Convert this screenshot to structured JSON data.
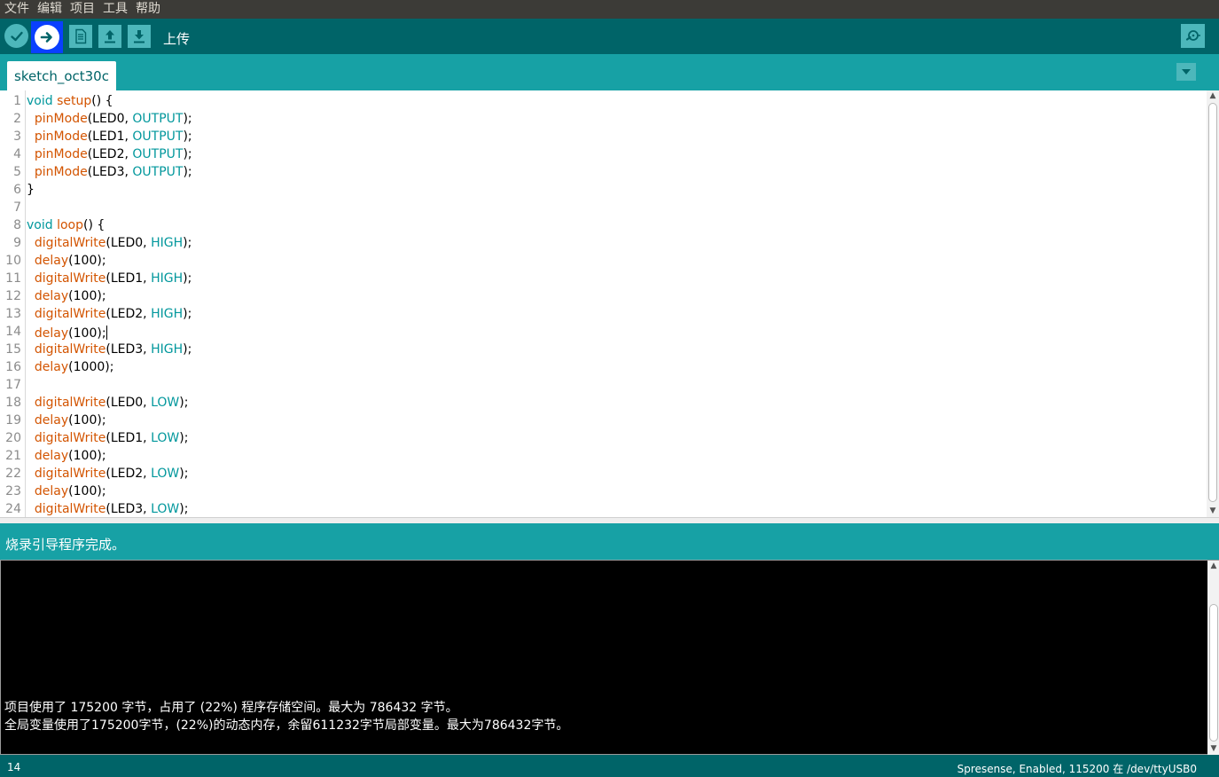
{
  "menubar": {
    "items": [
      "文件",
      "编辑",
      "项目",
      "工具",
      "帮助"
    ]
  },
  "toolbar": {
    "verify_icon": "check-icon",
    "upload_icon": "arrow-right-icon",
    "new_icon": "file-icon",
    "open_icon": "arrow-up-icon",
    "save_icon": "arrow-down-icon",
    "serial_icon": "magnifier-icon",
    "hover_label": "上传"
  },
  "tabs": {
    "active_tab": "sketch_oct30c",
    "menu_icon": "triangle-down-icon"
  },
  "editor": {
    "cursor_line": 14,
    "lines": [
      {
        "n": "1",
        "tokens": [
          {
            "c": "kw",
            "t": "void "
          },
          {
            "c": "fn",
            "t": "setup"
          },
          {
            "c": "pl",
            "t": "() {"
          }
        ]
      },
      {
        "n": "2",
        "tokens": [
          {
            "c": "pl",
            "t": "  "
          },
          {
            "c": "fn",
            "t": "pinMode"
          },
          {
            "c": "pl",
            "t": "(LED0, "
          },
          {
            "c": "kw",
            "t": "OUTPUT"
          },
          {
            "c": "pl",
            "t": ");"
          }
        ]
      },
      {
        "n": "3",
        "tokens": [
          {
            "c": "pl",
            "t": "  "
          },
          {
            "c": "fn",
            "t": "pinMode"
          },
          {
            "c": "pl",
            "t": "(LED1, "
          },
          {
            "c": "kw",
            "t": "OUTPUT"
          },
          {
            "c": "pl",
            "t": ");"
          }
        ]
      },
      {
        "n": "4",
        "tokens": [
          {
            "c": "pl",
            "t": "  "
          },
          {
            "c": "fn",
            "t": "pinMode"
          },
          {
            "c": "pl",
            "t": "(LED2, "
          },
          {
            "c": "kw",
            "t": "OUTPUT"
          },
          {
            "c": "pl",
            "t": ");"
          }
        ]
      },
      {
        "n": "5",
        "tokens": [
          {
            "c": "pl",
            "t": "  "
          },
          {
            "c": "fn",
            "t": "pinMode"
          },
          {
            "c": "pl",
            "t": "(LED3, "
          },
          {
            "c": "kw",
            "t": "OUTPUT"
          },
          {
            "c": "pl",
            "t": ");"
          }
        ]
      },
      {
        "n": "6",
        "tokens": [
          {
            "c": "pl",
            "t": "}"
          }
        ]
      },
      {
        "n": "7",
        "tokens": []
      },
      {
        "n": "8",
        "tokens": [
          {
            "c": "kw",
            "t": "void "
          },
          {
            "c": "fn",
            "t": "loop"
          },
          {
            "c": "pl",
            "t": "() {"
          }
        ]
      },
      {
        "n": "9",
        "tokens": [
          {
            "c": "pl",
            "t": "  "
          },
          {
            "c": "fn",
            "t": "digitalWrite"
          },
          {
            "c": "pl",
            "t": "(LED0, "
          },
          {
            "c": "kw",
            "t": "HIGH"
          },
          {
            "c": "pl",
            "t": ");"
          }
        ]
      },
      {
        "n": "10",
        "tokens": [
          {
            "c": "pl",
            "t": "  "
          },
          {
            "c": "fn",
            "t": "delay"
          },
          {
            "c": "pl",
            "t": "(100);"
          }
        ]
      },
      {
        "n": "11",
        "tokens": [
          {
            "c": "pl",
            "t": "  "
          },
          {
            "c": "fn",
            "t": "digitalWrite"
          },
          {
            "c": "pl",
            "t": "(LED1, "
          },
          {
            "c": "kw",
            "t": "HIGH"
          },
          {
            "c": "pl",
            "t": ");"
          }
        ]
      },
      {
        "n": "12",
        "tokens": [
          {
            "c": "pl",
            "t": "  "
          },
          {
            "c": "fn",
            "t": "delay"
          },
          {
            "c": "pl",
            "t": "(100);"
          }
        ]
      },
      {
        "n": "13",
        "tokens": [
          {
            "c": "pl",
            "t": "  "
          },
          {
            "c": "fn",
            "t": "digitalWrite"
          },
          {
            "c": "pl",
            "t": "(LED2, "
          },
          {
            "c": "kw",
            "t": "HIGH"
          },
          {
            "c": "pl",
            "t": ");"
          }
        ]
      },
      {
        "n": "14",
        "tokens": [
          {
            "c": "pl",
            "t": "  "
          },
          {
            "c": "fn",
            "t": "delay"
          },
          {
            "c": "pl",
            "t": "(100);"
          }
        ]
      },
      {
        "n": "15",
        "tokens": [
          {
            "c": "pl",
            "t": "  "
          },
          {
            "c": "fn",
            "t": "digitalWrite"
          },
          {
            "c": "pl",
            "t": "(LED3, "
          },
          {
            "c": "kw",
            "t": "HIGH"
          },
          {
            "c": "pl",
            "t": ");"
          }
        ]
      },
      {
        "n": "16",
        "tokens": [
          {
            "c": "pl",
            "t": "  "
          },
          {
            "c": "fn",
            "t": "delay"
          },
          {
            "c": "pl",
            "t": "(1000);"
          }
        ]
      },
      {
        "n": "17",
        "tokens": []
      },
      {
        "n": "18",
        "tokens": [
          {
            "c": "pl",
            "t": "  "
          },
          {
            "c": "fn",
            "t": "digitalWrite"
          },
          {
            "c": "pl",
            "t": "(LED0, "
          },
          {
            "c": "kw",
            "t": "LOW"
          },
          {
            "c": "pl",
            "t": ");"
          }
        ]
      },
      {
        "n": "19",
        "tokens": [
          {
            "c": "pl",
            "t": "  "
          },
          {
            "c": "fn",
            "t": "delay"
          },
          {
            "c": "pl",
            "t": "(100);"
          }
        ]
      },
      {
        "n": "20",
        "tokens": [
          {
            "c": "pl",
            "t": "  "
          },
          {
            "c": "fn",
            "t": "digitalWrite"
          },
          {
            "c": "pl",
            "t": "(LED1, "
          },
          {
            "c": "kw",
            "t": "LOW"
          },
          {
            "c": "pl",
            "t": ");"
          }
        ]
      },
      {
        "n": "21",
        "tokens": [
          {
            "c": "pl",
            "t": "  "
          },
          {
            "c": "fn",
            "t": "delay"
          },
          {
            "c": "pl",
            "t": "(100);"
          }
        ]
      },
      {
        "n": "22",
        "tokens": [
          {
            "c": "pl",
            "t": "  "
          },
          {
            "c": "fn",
            "t": "digitalWrite"
          },
          {
            "c": "pl",
            "t": "(LED2, "
          },
          {
            "c": "kw",
            "t": "LOW"
          },
          {
            "c": "pl",
            "t": ");"
          }
        ]
      },
      {
        "n": "23",
        "tokens": [
          {
            "c": "pl",
            "t": "  "
          },
          {
            "c": "fn",
            "t": "delay"
          },
          {
            "c": "pl",
            "t": "(100);"
          }
        ]
      },
      {
        "n": "24",
        "tokens": [
          {
            "c": "pl",
            "t": "  "
          },
          {
            "c": "fn",
            "t": "digitalWrite"
          },
          {
            "c": "pl",
            "t": "(LED3, "
          },
          {
            "c": "kw",
            "t": "LOW"
          },
          {
            "c": "pl",
            "t": ");"
          }
        ]
      }
    ]
  },
  "message_bar": {
    "text": "烧录引导程序完成。"
  },
  "console": {
    "lines": [
      "项目使用了 175200 字节，占用了 (22%) 程序存储空间。最大为 786432 字节。",
      "全局变量使用了175200字节，(22%)的动态内存，余留611232字节局部变量。最大为786432字节。"
    ]
  },
  "statusbar": {
    "line_number": "14",
    "board_info": "Spresense, Enabled, 115200 在 /dev/ttyUSB0"
  },
  "colors": {
    "menubar_bg": "#3c3b37",
    "toolbar_bg": "#006468",
    "accent": "#17a1a5",
    "button_bg": "#4db7bb",
    "keyword": "#00979c",
    "function": "#d35400",
    "upload_highlight": "#0a3fff"
  }
}
